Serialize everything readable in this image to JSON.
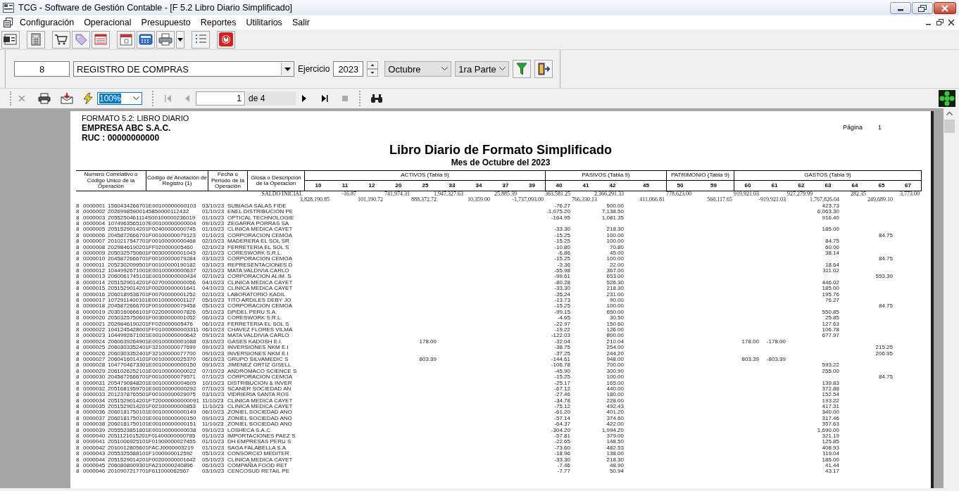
{
  "window": {
    "title": "TCG - Software de Gestión Contable - [F 5.2 Libro Diario Simplificado]"
  },
  "menu": [
    "Configuración",
    "Operacional",
    "Presupuesto",
    "Reportes",
    "Utilitarios",
    "Salir"
  ],
  "filter": {
    "code": "8",
    "book": "REGISTRO DE COMPRAS",
    "year_label": "Ejercicio",
    "year": "2023",
    "month": "Octubre",
    "part": "1ra Parte"
  },
  "viewer": {
    "zoom": "100%",
    "page": "1",
    "page_total": "de 4"
  },
  "report": {
    "format": "FORMATO 5.2: LIBRO DIARIO",
    "company": "EMPRESA ABC S.A.C.",
    "ruc": "RUC : 00000000000",
    "page_label": "Página",
    "page": "1",
    "title": "Libro Diario de Formato Simplificado",
    "subtitle": "Mes de Octubre del 2023",
    "headers": [
      "Numero Correlativo o Código Unico de la Operación",
      "Código de Anotación de Registro (1)",
      "Fecha o Periodo de la Operación",
      "Glosa o Descripción de la Operacion"
    ],
    "groups": [
      {
        "label": "ACTIVOS (Tabla 9)",
        "columns": [
          "10",
          "11",
          "12",
          "20",
          "25",
          "33",
          "34",
          "37",
          "39"
        ]
      },
      {
        "label": "PASIVOS (Tabla 9)",
        "columns": [
          "40",
          "41",
          "42",
          "45"
        ]
      },
      {
        "label": "PATRIMONIO (Tabla 9)",
        "columns": [
          "50",
          "59"
        ]
      },
      {
        "label": "GASTOS (Tabla 9)",
        "columns": [
          "60",
          "61",
          "62",
          "63",
          "64",
          "65",
          "67"
        ]
      }
    ],
    "opening": {
      "label": "SALDO INICIAL",
      "amounts": {
        "10": "3,828,190.85",
        "11": "-16.87",
        "12": "101,190.72",
        "20": "741,974.31",
        "25": "888,372.72",
        "33": "1,947,327.63",
        "34": "10,359.00",
        "37": "25,885.39",
        "39": "-1,737,093.00",
        "40": "363,581.25",
        "41": "766,330.13",
        "42": "2,366,291.33",
        "45": "411,066.81",
        "50": "778,623.00",
        "59": "560,117.65",
        "60": "919,921.03",
        "61": "-919,921.03",
        "62": "927,279.99",
        "63": "1,767,826.04",
        "64": "282.35",
        "65": "249,689.10",
        "67": "3,773.00"
      }
    },
    "rows": [
      {
        "book": "8",
        "number": "0000001",
        "code": "1560434266701E00100000000103",
        "date": "03/10/23",
        "gloss": "SUBIAGA SALAS FIDE",
        "amounts": {
          "40": "-76.27",
          "42": "500.00",
          "63": "423.73"
        }
      },
      {
        "book": "8",
        "number": "0000002",
        "code": "20269985900145850000112432",
        "date": "01/10/23",
        "gloss": "ENEL DISTRIBUCION PE",
        "amounts": {
          "40": "-1,075.20",
          "42": "7,138.50",
          "63": "6,063.30"
        }
      },
      {
        "book": "8",
        "number": "0000003",
        "code": "2055250461114S00100000236019",
        "date": "01/10/23",
        "gloss": "OPTICAL TECHNOLOGIE",
        "amounts": {
          "40": "-164.95",
          "42": "1,081.35",
          "63": "916.40"
        }
      },
      {
        "book": "8",
        "number": "0000004",
        "code": "1074963565107E00100000000004",
        "date": "09/10/23",
        "gloss": "ZEGARRA PORRAS SA",
        "amounts": {}
      },
      {
        "book": "8",
        "number": "0000005",
        "code": "2051529014201F02400000000745",
        "date": "01/10/23",
        "gloss": "CLINICA MEDICA CAYET",
        "amounts": {
          "40": "-33.30",
          "42": "218.30",
          "63": "185.00"
        }
      },
      {
        "book": "8",
        "number": "0000006",
        "code": "2045872666701F00100000079123",
        "date": "01/10/23",
        "gloss": "CORPORACION CEMOA",
        "amounts": {
          "40": "-15.25",
          "42": "100.00",
          "65": "84.75"
        }
      },
      {
        "book": "8",
        "number": "0000007",
        "code": "2010217547701F00100000000468",
        "date": "02/10/23",
        "gloss": "MADERERA EL SOL SR",
        "amounts": {
          "40": "-15.25",
          "42": "100.00",
          "63": "84.75"
        }
      },
      {
        "book": "8",
        "number": "0000008",
        "code": "2029846190201FF020000005460",
        "date": "02/10/23",
        "gloss": "FERRETERIA EL SOL S",
        "amounts": {
          "40": "-10.80",
          "42": "70.80",
          "63": "60.00"
        }
      },
      {
        "book": "8",
        "number": "0000009",
        "code": "2050325750601F00300000001043",
        "date": "02/10/23",
        "gloss": "CORESWORK S.R.L.",
        "amounts": {
          "40": "-6.86",
          "42": "45.00",
          "63": "38.14"
        }
      },
      {
        "book": "8",
        "number": "0000010",
        "code": "2045872666701F00100000079284",
        "date": "03/10/23",
        "gloss": "CORPORACION CEMOA",
        "amounts": {
          "40": "-15.25",
          "42": "100.00",
          "65": "84.75"
        }
      },
      {
        "book": "8",
        "number": "0000011",
        "code": "2052302099501F00100000190182",
        "date": "03/10/23",
        "gloss": "REPRESENTACIONES D",
        "amounts": {
          "40": "-3.36",
          "42": "22.00",
          "63": "18.64"
        }
      },
      {
        "book": "8",
        "number": "0000012",
        "code": "1044992671001E00100000000637",
        "date": "02/10/23",
        "gloss": "MATA VALDIVIA CARLO",
        "amounts": {
          "40": "-55.98",
          "42": "367.00",
          "63": "311.02"
        }
      },
      {
        "book": "8",
        "number": "0000013",
        "code": "2060061745101E00100000000434",
        "date": "02/10/23",
        "gloss": "CORPORACION ALIM. S",
        "amounts": {
          "40": "-99.61",
          "42": "653.00",
          "65": "553.39"
        }
      },
      {
        "book": "8",
        "number": "0000014",
        "code": "2051529014201F02700000000056",
        "date": "04/10/23",
        "gloss": "CLINICA MEDICA CAYET",
        "amounts": {
          "40": "-80.28",
          "42": "526.30",
          "63": "446.02"
        }
      },
      {
        "book": "8",
        "number": "0000015",
        "code": "2051529014201F00200000001641",
        "date": "04/10/23",
        "gloss": "CLINICA MEDICA CAYET",
        "amounts": {
          "40": "-33.30",
          "42": "218.30",
          "63": "185.00"
        }
      },
      {
        "book": "8",
        "number": "0000016",
        "code": "2060189536701F00700000001252",
        "date": "02/10/23",
        "gloss": "LABORATORIO KADIL",
        "amounts": {
          "40": "-35.24",
          "42": "231.00",
          "63": "195.76"
        }
      },
      {
        "book": "8",
        "number": "0000017",
        "code": "1072911400101E00100000001127",
        "date": "05/10/23",
        "gloss": "TITO ARDILES DEBY JO",
        "amounts": {
          "40": "-13.73",
          "42": "90.00",
          "63": "76.27"
        }
      },
      {
        "book": "8",
        "number": "0000018",
        "code": "2045872666701F00100000079458",
        "date": "05/10/23",
        "gloss": "CORPORACION CEMOA",
        "amounts": {
          "40": "-15.25",
          "42": "100.00",
          "65": "84.75"
        }
      },
      {
        "book": "8",
        "number": "0000019",
        "code": "2030160666101F02200000007826",
        "date": "05/10/23",
        "gloss": "DPIDEL PERU S.A.",
        "amounts": {
          "40": "-99.15",
          "42": "650.00",
          "63": "550.85"
        }
      },
      {
        "book": "8",
        "number": "0000020",
        "code": "2050325750601F00300000001052",
        "date": "06/10/23",
        "gloss": "CORESWORK S.R.L.",
        "amounts": {
          "40": "-4.65",
          "42": "30.50",
          "63": "25.85"
        }
      },
      {
        "book": "8",
        "number": "0000021",
        "code": "2029846190201FF020000005476",
        "date": "06/10/23",
        "gloss": "FERRETERIA EL SOL S",
        "amounts": {
          "40": "-22.97",
          "42": "150.60",
          "63": "127.63"
        }
      },
      {
        "book": "8",
        "number": "0000022",
        "code": "1041245428001FF01000000003311",
        "date": "06/10/23",
        "gloss": "CHAVEZ FLORES VILMA",
        "amounts": {
          "40": "-19.22",
          "42": "126.00",
          "63": "106.78"
        }
      },
      {
        "book": "8",
        "number": "0000023",
        "code": "1044992671001E00100000000642",
        "date": "09/10/23",
        "gloss": "MATA VALDIVIA CARLO",
        "amounts": {
          "40": "-122.03",
          "42": "800.00",
          "63": "677.97"
        }
      },
      {
        "book": "8",
        "number": "0000024",
        "code": "2060639264901E00100000001088",
        "date": "03/10/23",
        "gloss": "GASES KADOSH E.I.",
        "amounts": {
          "25": "178.00",
          "40": "-32.04",
          "42": "210.04",
          "60": "178.00",
          "61": "-178.00"
        }
      },
      {
        "book": "8",
        "number": "0000025",
        "code": "2060303352401F32100000077699",
        "date": "09/10/23",
        "gloss": "INVERSIONES NKM E.I",
        "amounts": {
          "40": "-38.75",
          "42": "254.00",
          "65": "215.25"
        }
      },
      {
        "book": "8",
        "number": "0000026",
        "code": "2060303352401F32100000077700",
        "date": "09/10/23",
        "gloss": "INVERSIONES NKM E.I",
        "amounts": {
          "40": "-37.25",
          "42": "244.20",
          "65": "206.95"
        }
      },
      {
        "book": "8",
        "number": "0000027",
        "code": "2060416014101F00100000025370",
        "date": "06/10/23",
        "gloss": "GRUPO SILVAMEDIC S",
        "amounts": {
          "25": "803.39",
          "40": "-144.61",
          "42": "948.00",
          "60": "803.39",
          "61": "-803.39"
        }
      },
      {
        "book": "8",
        "number": "0000028",
        "code": "1047704673301E00100000000150",
        "date": "09/10/23",
        "gloss": "JIMENEZ ORTIZ GISELL",
        "amounts": {
          "40": "-106.78",
          "42": "700.00",
          "63": "593.22"
        }
      },
      {
        "book": "8",
        "number": "0000029",
        "code": "2061026252101E00100000000022",
        "date": "07/10/23",
        "gloss": "ANDROMACO SCIENCE S",
        "amounts": {
          "40": "-45.90",
          "42": "300.90",
          "63": "255.00"
        }
      },
      {
        "book": "8",
        "number": "0000030",
        "code": "2045872666701F00100000079571",
        "date": "07/10/23",
        "gloss": "CORPORACION CEMOA",
        "amounts": {
          "40": "-15.25",
          "42": "100.00",
          "65": "84.75"
        }
      },
      {
        "book": "8",
        "number": "0000031",
        "code": "2054790848201E00100000004605",
        "date": "10/10/23",
        "gloss": "DISTRIBUCION & INVER",
        "amounts": {
          "40": "-25.17",
          "42": "165.00",
          "63": "139.83"
        }
      },
      {
        "book": "8",
        "number": "0000032",
        "code": "2051681959701E00100000000292",
        "date": "07/10/23",
        "gloss": "SCANER SOCIEDAD AN",
        "amounts": {
          "40": "-67.12",
          "42": "440.00",
          "63": "372.88"
        }
      },
      {
        "book": "8",
        "number": "0000033",
        "code": "2012378765501F00100000029075",
        "date": "03/10/23",
        "gloss": "VIDRIERIA SANTA ROS",
        "amounts": {
          "40": "-27.46",
          "42": "180.00",
          "63": "152.54"
        }
      },
      {
        "book": "8",
        "number": "0000034",
        "code": "2051529014201FT20000000000091",
        "date": "11/10/23",
        "gloss": "CLINICA MEDICA CAYET",
        "amounts": {
          "40": "-34.78",
          "42": "228.00",
          "63": "193.22"
        }
      },
      {
        "book": "8",
        "number": "0000035",
        "code": "2051529014201F02100000000853",
        "date": "11/10/23",
        "gloss": "CLINICA MEDICA CAYET",
        "amounts": {
          "40": "-75.12",
          "42": "492.43",
          "63": "417.31"
        }
      },
      {
        "book": "8",
        "number": "0000036",
        "code": "2060181750101E00100000000149",
        "date": "06/10/23",
        "gloss": "ZONIEL SOCIEDAD ANO",
        "amounts": {
          "40": "-61.20",
          "42": "401.20",
          "63": "340.00"
        }
      },
      {
        "book": "8",
        "number": "0000037",
        "code": "2060181750101E00100000000150",
        "date": "09/10/23",
        "gloss": "ZONIEL SOCIEDAD ANO",
        "amounts": {
          "40": "-57.14",
          "42": "374.60",
          "63": "317.46"
        }
      },
      {
        "book": "8",
        "number": "0000038",
        "code": "2060181750101E00100000000151",
        "date": "11/10/23",
        "gloss": "ZONIEL SOCIEDAD ANO",
        "amounts": {
          "40": "-64.37",
          "42": "422.00",
          "63": "357.63"
        }
      },
      {
        "book": "8",
        "number": "0000039",
        "code": "2055523851801E00100000000038",
        "date": "09/10/23",
        "gloss": "LOSHECA S.A.C.",
        "amounts": {
          "40": "-304.20",
          "42": "1,994.20",
          "63": "1,690.00"
        }
      },
      {
        "book": "8",
        "number": "0000040",
        "code": "2051121015201F01400000000785",
        "date": "01/10/23",
        "gloss": "IMPORTACIONES PAEZ S",
        "amounts": {
          "40": "-57.81",
          "42": "379.00",
          "63": "321.19"
        }
      },
      {
        "book": "8",
        "number": "0000041",
        "code": "2051006925101F01900000027455",
        "date": "01/10/23",
        "gloss": "DH EMPRESAS PERU S",
        "amounts": {
          "40": "-22.65",
          "42": "148.50",
          "63": "125.85"
        }
      },
      {
        "book": "8",
        "number": "0000042",
        "code": "2010012805601FACJ0000003219",
        "date": "01/10/23",
        "gloss": "SAGA FALABELLA S.A",
        "amounts": {
          "40": "-73.60",
          "42": "482.53",
          "63": "408.93"
        }
      },
      {
        "book": "8",
        "number": "0000043",
        "code": "2055325588101F1000000012592",
        "date": "05/10/23",
        "gloss": "CONSORCIO MEDITER",
        "amounts": {
          "40": "-18.96",
          "42": "138.00",
          "63": "119.04"
        }
      },
      {
        "book": "8",
        "number": "0000044",
        "code": "2051529014201F00200000001642",
        "date": "05/10/23",
        "gloss": "CLINICA MEDICA CAYET",
        "amounts": {
          "40": "-33.30",
          "42": "218.30",
          "63": "185.00"
        }
      },
      {
        "book": "8",
        "number": "0000045",
        "code": "2060808009301FA210000240896",
        "date": "06/10/23",
        "gloss": "COMPAÑIA FOOD RET",
        "amounts": {
          "40": "-7.46",
          "42": "48.90",
          "63": "41.44"
        }
      },
      {
        "book": "8",
        "number": "0000046",
        "code": "2010907217701F611000062567",
        "date": "03/10/23",
        "gloss": "CENCOSUD RETAIL PE",
        "amounts": {
          "40": "-7.77",
          "42": "50.94",
          "63": "43.17"
        }
      }
    ]
  }
}
